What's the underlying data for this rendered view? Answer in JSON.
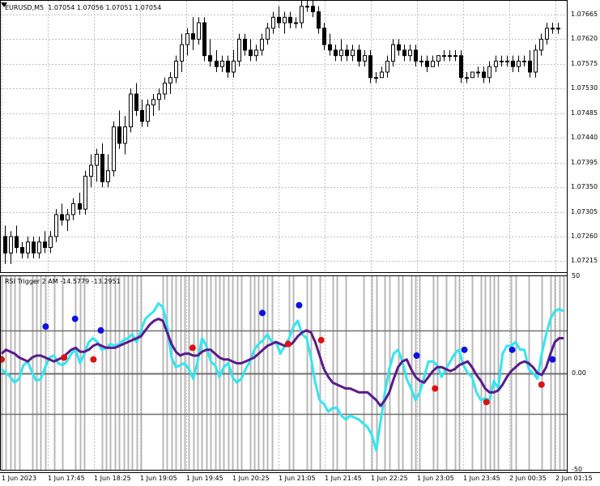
{
  "window": {
    "symbol": "EURUSD,M5",
    "ohlc": "1.07054 1.07056 1.07051 1.07054",
    "indicator_title": "RSI Trigger 2 AM -14.5779 -13.2951"
  },
  "colors": {
    "background": "#ffffff",
    "candle_outline": "#000000",
    "grid": "#c0c0c0",
    "histogram": "#b8b8b8",
    "level_line": "#707070",
    "fast_rsi": "#33e6f0",
    "slow_rsi": "#5a1a8c",
    "buy_dot": "#1010e0",
    "sell_dot": "#e01010"
  },
  "icons": {
    "symbol_marker": "triangle-down-icon"
  },
  "price_axis": [
    "1.07665",
    "1.07620",
    "1.07575",
    "1.07530",
    "1.07485",
    "1.07440",
    "1.07395",
    "1.07350",
    "1.07305",
    "1.07260",
    "1.07215"
  ],
  "indicator_axis": [
    "50",
    "0.00",
    "-50"
  ],
  "time_axis": [
    "1 Jun 2023",
    "1 Jun 17:45",
    "1 Jun 18:25",
    "1 Jun 19:05",
    "1 Jun 19:45",
    "1 Jun 20:25",
    "1 Jun 21:05",
    "1 Jun 21:45",
    "1 Jun 22:25",
    "1 Jun 23:05",
    "1 Jun 23:45",
    "2 Jun 00:35",
    "2 Jun 01:15"
  ],
  "chart_data": [
    {
      "type": "candlestick",
      "title": "EURUSD,M5",
      "ylim": [
        1.07195,
        1.0769
      ],
      "candles": [
        [
          1.0726,
          1.0728,
          1.0721,
          1.0723
        ],
        [
          1.0723,
          1.0727,
          1.0721,
          1.0726
        ],
        [
          1.0726,
          1.0728,
          1.0723,
          1.0724
        ],
        [
          1.0724,
          1.0725,
          1.0722,
          1.0723
        ],
        [
          1.0723,
          1.0726,
          1.0722,
          1.0725
        ],
        [
          1.0725,
          1.0726,
          1.0722,
          1.0723
        ],
        [
          1.0723,
          1.0726,
          1.0722,
          1.0725
        ],
        [
          1.0725,
          1.0727,
          1.0723,
          1.0724
        ],
        [
          1.0724,
          1.0727,
          1.0723,
          1.0726
        ],
        [
          1.0726,
          1.0731,
          1.0725,
          1.073
        ],
        [
          1.073,
          1.0732,
          1.0728,
          1.0729
        ],
        [
          1.0729,
          1.0731,
          1.0727,
          1.073
        ],
        [
          1.073,
          1.0733,
          1.0729,
          1.0732
        ],
        [
          1.0732,
          1.0734,
          1.073,
          1.0731
        ],
        [
          1.0731,
          1.0738,
          1.073,
          1.0737
        ],
        [
          1.0737,
          1.0741,
          1.0735,
          1.0739
        ],
        [
          1.0739,
          1.0742,
          1.0736,
          1.0741
        ],
        [
          1.0741,
          1.0743,
          1.0735,
          1.0736
        ],
        [
          1.0736,
          1.0741,
          1.0735,
          1.0738
        ],
        [
          1.0738,
          1.0747,
          1.0737,
          1.0746
        ],
        [
          1.0746,
          1.0749,
          1.0742,
          1.0743
        ],
        [
          1.0743,
          1.0748,
          1.0741,
          1.0746
        ],
        [
          1.0746,
          1.0753,
          1.0745,
          1.0752
        ],
        [
          1.0752,
          1.0754,
          1.0748,
          1.0749
        ],
        [
          1.0749,
          1.0751,
          1.0746,
          1.0747
        ],
        [
          1.0747,
          1.0751,
          1.0746,
          1.075
        ],
        [
          1.075,
          1.0752,
          1.0748,
          1.0751
        ],
        [
          1.0751,
          1.0753,
          1.0749,
          1.0752
        ],
        [
          1.0752,
          1.0755,
          1.0751,
          1.0754
        ],
        [
          1.0754,
          1.0756,
          1.0752,
          1.0755
        ],
        [
          1.0755,
          1.0759,
          1.0754,
          1.0758
        ],
        [
          1.0758,
          1.0763,
          1.0756,
          1.0761
        ],
        [
          1.0761,
          1.0764,
          1.0759,
          1.0763
        ],
        [
          1.0763,
          1.0766,
          1.076,
          1.0762
        ],
        [
          1.0762,
          1.0766,
          1.0761,
          1.0765
        ],
        [
          1.0765,
          1.0766,
          1.0758,
          1.0759
        ],
        [
          1.0759,
          1.0762,
          1.0757,
          1.0758
        ],
        [
          1.0758,
          1.076,
          1.0756,
          1.0757
        ],
        [
          1.0757,
          1.0759,
          1.0756,
          1.0758
        ],
        [
          1.0758,
          1.0759,
          1.0755,
          1.0756
        ],
        [
          1.0756,
          1.076,
          1.0755,
          1.0758
        ],
        [
          1.0758,
          1.0763,
          1.0757,
          1.0762
        ],
        [
          1.0762,
          1.0763,
          1.0759,
          1.076
        ],
        [
          1.076,
          1.0762,
          1.0758,
          1.0759
        ],
        [
          1.0759,
          1.0761,
          1.0758,
          1.076
        ],
        [
          1.076,
          1.0763,
          1.0759,
          1.0762
        ],
        [
          1.0762,
          1.0765,
          1.0761,
          1.0764
        ],
        [
          1.0764,
          1.0767,
          1.0763,
          1.0766
        ],
        [
          1.0766,
          1.0768,
          1.0764,
          1.0765
        ],
        [
          1.0765,
          1.0767,
          1.0763,
          1.0766
        ],
        [
          1.0766,
          1.0767,
          1.0764,
          1.0765
        ],
        [
          1.0765,
          1.0766,
          1.0764,
          1.0765
        ],
        [
          1.0765,
          1.0769,
          1.0764,
          1.0768
        ],
        [
          1.0768,
          1.0769,
          1.0767,
          1.0768
        ],
        [
          1.0768,
          1.0769,
          1.0766,
          1.0767
        ],
        [
          1.0767,
          1.0768,
          1.0763,
          1.0764
        ],
        [
          1.0764,
          1.0765,
          1.076,
          1.0761
        ],
        [
          1.0761,
          1.0763,
          1.0759,
          1.076
        ],
        [
          1.076,
          1.0761,
          1.0758,
          1.0759
        ],
        [
          1.0759,
          1.0762,
          1.0758,
          1.076
        ],
        [
          1.076,
          1.0761,
          1.0758,
          1.0759
        ],
        [
          1.0759,
          1.0761,
          1.0758,
          1.076
        ],
        [
          1.076,
          1.0761,
          1.0757,
          1.0758
        ],
        [
          1.0758,
          1.076,
          1.0757,
          1.0759
        ],
        [
          1.0759,
          1.076,
          1.0754,
          1.0755
        ],
        [
          1.0755,
          1.0756,
          1.0754,
          1.0755
        ],
        [
          1.0755,
          1.0757,
          1.0755,
          1.0756
        ],
        [
          1.0756,
          1.0759,
          1.0755,
          1.0758
        ],
        [
          1.0758,
          1.0762,
          1.0757,
          1.0761
        ],
        [
          1.0761,
          1.0762,
          1.0759,
          1.076
        ],
        [
          1.076,
          1.0761,
          1.0758,
          1.0759
        ],
        [
          1.0759,
          1.0761,
          1.0758,
          1.076
        ],
        [
          1.076,
          1.0761,
          1.0757,
          1.0758
        ],
        [
          1.0758,
          1.0759,
          1.0757,
          1.0758
        ],
        [
          1.0758,
          1.0759,
          1.0756,
          1.0757
        ],
        [
          1.0757,
          1.0759,
          1.0757,
          1.0758
        ],
        [
          1.0758,
          1.0759,
          1.0757,
          1.0759
        ],
        [
          1.0759,
          1.076,
          1.0758,
          1.0759
        ],
        [
          1.0759,
          1.076,
          1.0758,
          1.0759
        ],
        [
          1.0759,
          1.076,
          1.0758,
          1.0759
        ],
        [
          1.0759,
          1.076,
          1.0754,
          1.0755
        ],
        [
          1.0755,
          1.0756,
          1.0754,
          1.0755
        ],
        [
          1.0755,
          1.0756,
          1.0755,
          1.0756
        ],
        [
          1.0756,
          1.0757,
          1.0755,
          1.0756
        ],
        [
          1.0756,
          1.0757,
          1.0754,
          1.0755
        ],
        [
          1.0755,
          1.0758,
          1.0754,
          1.0757
        ],
        [
          1.0757,
          1.0759,
          1.0756,
          1.0758
        ],
        [
          1.0758,
          1.0759,
          1.0757,
          1.0758
        ],
        [
          1.0758,
          1.0759,
          1.0757,
          1.0758
        ],
        [
          1.0758,
          1.0759,
          1.0756,
          1.0757
        ],
        [
          1.0757,
          1.0759,
          1.0756,
          1.0758
        ],
        [
          1.0758,
          1.0759,
          1.0757,
          1.0758
        ],
        [
          1.0758,
          1.076,
          1.0755,
          1.0756
        ],
        [
          1.0756,
          1.0761,
          1.0755,
          1.076
        ],
        [
          1.076,
          1.0763,
          1.0759,
          1.0762
        ],
        [
          1.0762,
          1.0765,
          1.0761,
          1.0764
        ],
        [
          1.0764,
          1.0765,
          1.0763,
          1.0764
        ],
        [
          1.0764,
          1.0765,
          1.0763,
          1.0764
        ]
      ]
    },
    {
      "type": "line",
      "title": "RSI Trigger 2 AM -14.5779 -13.2951",
      "ylim": [
        -50,
        50
      ],
      "levels": [
        22,
        0,
        -21
      ],
      "series": [
        {
          "values": [
            2,
            0,
            -2,
            -5,
            -3,
            4,
            6,
            0,
            -4,
            -3,
            3,
            8,
            9,
            5,
            4,
            6,
            10,
            12,
            5,
            10,
            16,
            18,
            16,
            12,
            13,
            15,
            14,
            15,
            17,
            18,
            20,
            16,
            22,
            28,
            30,
            32,
            36,
            34,
            25,
            8,
            3,
            4,
            5,
            2,
            -3,
            6,
            18,
            14,
            6,
            4,
            -2,
            3,
            5,
            -2,
            -5,
            -3,
            2,
            6,
            12,
            15,
            17,
            20,
            16,
            16,
            10,
            14,
            18,
            24,
            27,
            20,
            18,
            8,
            -5,
            -14,
            -16,
            -20,
            -18,
            -18,
            -22,
            -24,
            -22,
            -23,
            -24,
            -26,
            -28,
            -32,
            -40,
            -25,
            -10,
            2,
            10,
            12,
            6,
            -3,
            -8,
            -14,
            -10,
            -2,
            6,
            6,
            4,
            -2,
            2,
            6,
            10,
            12,
            4,
            0,
            -2,
            -10,
            -14,
            -13,
            -14,
            -4,
            -8,
            10,
            14,
            14,
            16,
            12,
            12,
            2,
            0,
            -3,
            10,
            20,
            28,
            32,
            33,
            32
          ]
        },
        {
          "values": [
            10,
            12,
            11,
            10,
            8,
            7,
            6,
            8,
            9,
            9,
            8,
            7,
            6,
            7,
            8,
            10,
            12,
            13,
            11,
            11,
            12,
            14,
            15,
            14,
            13,
            13,
            13,
            14,
            15,
            16,
            17,
            18,
            19,
            22,
            25,
            27,
            28,
            27,
            21,
            15,
            11,
            9,
            10,
            10,
            9,
            9,
            11,
            12,
            12,
            10,
            8,
            7,
            7,
            6,
            5,
            5,
            6,
            7,
            8,
            10,
            12,
            14,
            15,
            16,
            15,
            14,
            14,
            16,
            19,
            21,
            22,
            21,
            16,
            9,
            2,
            -2,
            -5,
            -6,
            -7,
            -8,
            -8,
            -9,
            -10,
            -10,
            -10,
            -12,
            -14,
            -17,
            -14,
            -10,
            -3,
            3,
            6,
            7,
            2,
            -2,
            -4,
            -5,
            -2,
            1,
            3,
            3,
            2,
            1,
            2,
            4,
            5,
            6,
            3,
            -1,
            -4,
            -8,
            -10,
            -10,
            -9,
            -6,
            -2,
            1,
            3,
            5,
            6,
            5,
            3,
            0,
            -1,
            3,
            10,
            16,
            18,
            18
          ]
        }
      ],
      "histogram": [
        1,
        1,
        1,
        1,
        1,
        0,
        0,
        1,
        1,
        1,
        1,
        0,
        1,
        0,
        1,
        0,
        0,
        1,
        1,
        1,
        0,
        0,
        0,
        1,
        1,
        1,
        1,
        1,
        1,
        1,
        1,
        1,
        1,
        0,
        0,
        0,
        0,
        1,
        1,
        1,
        1,
        1,
        1,
        1,
        1,
        1,
        1,
        1,
        1,
        1,
        1,
        1,
        1,
        1,
        1,
        1,
        0,
        1,
        1,
        1,
        1,
        1,
        1,
        0,
        0,
        0,
        1,
        1,
        0,
        0,
        1,
        1,
        0,
        1,
        0,
        0,
        1,
        1,
        0,
        1,
        0,
        0,
        0,
        1,
        0,
        1,
        1,
        0,
        1,
        1,
        0,
        1,
        1,
        0,
        1,
        1,
        1,
        0,
        0,
        1,
        1,
        0,
        1,
        0,
        1,
        1,
        0,
        0,
        1,
        0,
        1,
        1,
        1,
        1,
        1,
        0,
        0,
        1,
        1,
        0,
        0,
        1,
        0,
        0,
        1,
        0,
        1,
        1,
        1,
        1
      ],
      "dots": [
        {
          "kind": "sell",
          "i": 0,
          "v": 7
        },
        {
          "kind": "buy",
          "i": 12,
          "v": 24
        },
        {
          "kind": "sell",
          "i": 17,
          "v": 8
        },
        {
          "kind": "buy",
          "i": 20,
          "v": 28
        },
        {
          "kind": "sell",
          "i": 25,
          "v": 7
        },
        {
          "kind": "buy",
          "i": 27,
          "v": 22
        },
        {
          "kind": "sell",
          "i": 52,
          "v": 13
        },
        {
          "kind": "buy",
          "i": 71,
          "v": 31
        },
        {
          "kind": "sell",
          "i": 78,
          "v": 15
        },
        {
          "kind": "buy",
          "i": 81,
          "v": 35
        },
        {
          "kind": "sell",
          "i": 87,
          "v": 17
        },
        {
          "kind": "buy",
          "i": 113,
          "v": 9
        },
        {
          "kind": "sell",
          "i": 118,
          "v": -8
        },
        {
          "kind": "buy",
          "i": 126,
          "v": 12
        },
        {
          "kind": "sell",
          "i": 132,
          "v": -15
        },
        {
          "kind": "buy",
          "i": 139,
          "v": 12
        },
        {
          "kind": "sell",
          "i": 147,
          "v": -6
        },
        {
          "kind": "buy",
          "i": 150,
          "v": 7
        }
      ]
    }
  ]
}
